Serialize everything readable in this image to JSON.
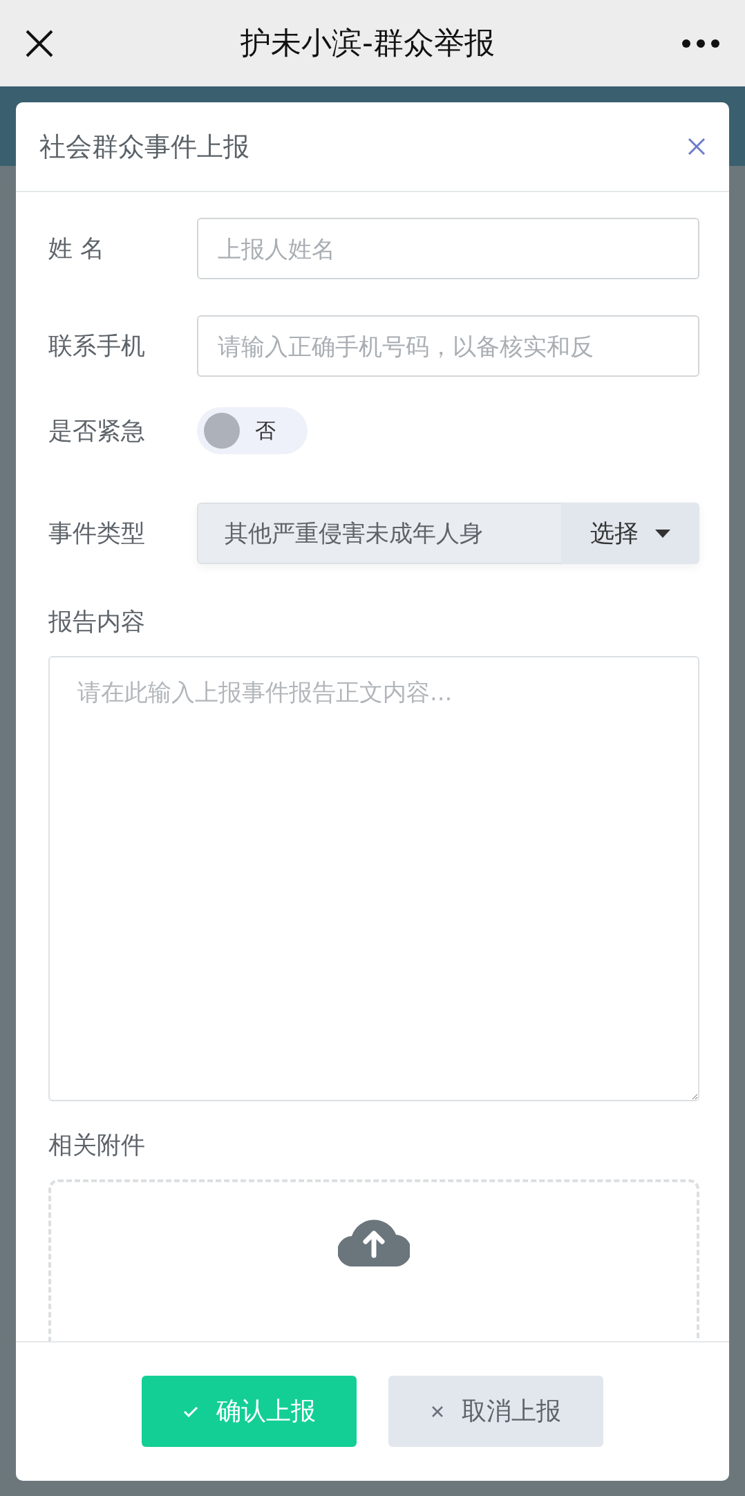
{
  "nav_bar": {
    "title": "护未小滨-群众举报"
  },
  "dialog": {
    "title": "社会群众事件上报",
    "fields": [
      {
        "kind": "text",
        "label": "姓 名",
        "placeholder": "上报人姓名"
      },
      {
        "kind": "text",
        "label": "联系手机",
        "placeholder": "请输入正确手机号码，以备核实和反"
      },
      {
        "kind": "switch",
        "label": "是否紧急",
        "on": false,
        "value": "否"
      },
      {
        "kind": "select",
        "label": "事件类型",
        "value": "其他严重侵害未成年人身",
        "button": "选择"
      }
    ],
    "report": {
      "label": "报告内容",
      "placeholder": "请在此输入上报事件报告正文内容..."
    },
    "attachments": {
      "label": "相关附件"
    },
    "buttons": [
      {
        "kind": "confirm",
        "label": "确认上报"
      },
      {
        "kind": "cancel",
        "label": "取消上报"
      }
    ]
  }
}
